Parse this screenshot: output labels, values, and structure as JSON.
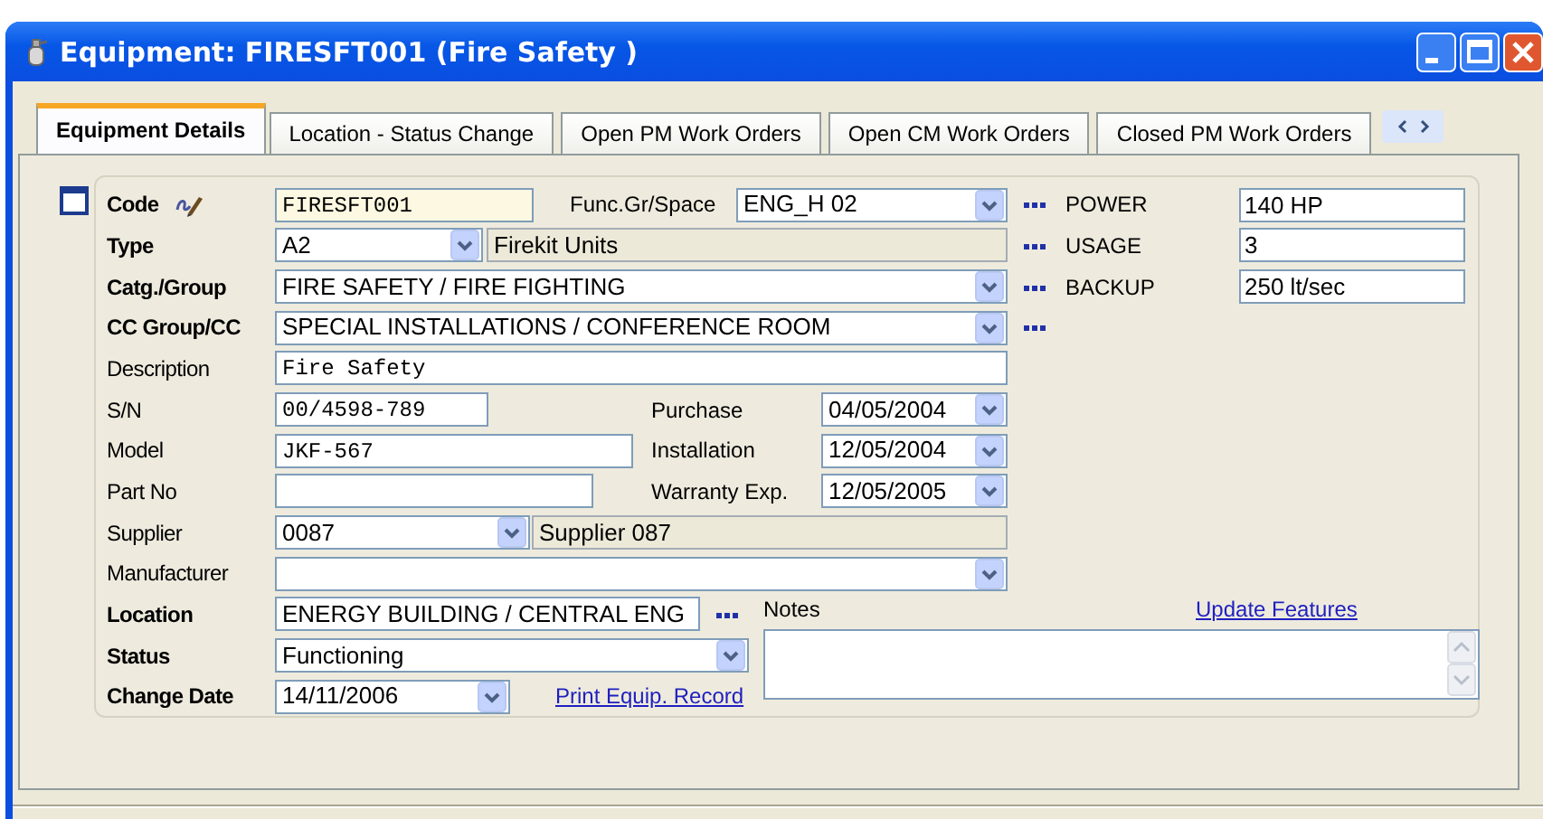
{
  "window": {
    "title": "Equipment: FIRESFT001 (Fire Safety )"
  },
  "tabs": [
    {
      "label": "Equipment Details",
      "selected": true
    },
    {
      "label": "Location - Status Change",
      "selected": false
    },
    {
      "label": "Open PM Work Orders",
      "selected": false
    },
    {
      "label": "Open CM Work Orders",
      "selected": false
    },
    {
      "label": "Closed PM Work Orders",
      "selected": false
    }
  ],
  "form": {
    "rows": [
      {
        "label": "Code",
        "required": true,
        "fields": [
          {
            "kind": "input",
            "value": "FIRESFT001",
            "highlighted": true
          },
          {
            "kind": "label",
            "text": "Func.Gr/Space"
          },
          {
            "kind": "select",
            "value": "ENG_H 02"
          },
          {
            "kind": "lookup"
          }
        ],
        "side": {
          "label": "POWER",
          "value": "140 HP"
        }
      },
      {
        "label": "Type",
        "required": true,
        "fields": [
          {
            "kind": "select",
            "value": "A2"
          },
          {
            "kind": "display",
            "value": "Firekit Units"
          },
          {
            "kind": "lookup"
          }
        ],
        "side": {
          "label": "USAGE",
          "value": "3"
        }
      },
      {
        "label": "Catg./Group",
        "required": true,
        "fields": [
          {
            "kind": "select",
            "value": "FIRE SAFETY / FIRE FIGHTING"
          },
          {
            "kind": "lookup"
          }
        ],
        "side": {
          "label": "BACKUP",
          "value": "250 lt/sec"
        }
      },
      {
        "label": "CC Group/CC",
        "required": true,
        "fields": [
          {
            "kind": "select",
            "value": "SPECIAL INSTALLATIONS / CONFERENCE ROOM"
          },
          {
            "kind": "lookup"
          }
        ]
      },
      {
        "label": "Description",
        "required": false,
        "fields": [
          {
            "kind": "input",
            "value": "Fire Safety",
            "highlighted": false
          }
        ]
      },
      {
        "label": "S/N",
        "required": false,
        "fields": [
          {
            "kind": "input",
            "value": "00/4598-789",
            "highlighted": false
          },
          {
            "kind": "label",
            "text": "Purchase"
          },
          {
            "kind": "date",
            "value": "04/05/2004"
          }
        ]
      },
      {
        "label": "Model",
        "required": false,
        "fields": [
          {
            "kind": "input",
            "value": "JKF-567",
            "highlighted": false
          },
          {
            "kind": "label",
            "text": "Installation"
          },
          {
            "kind": "date",
            "value": "12/05/2004"
          }
        ]
      },
      {
        "label": "Part No",
        "required": false,
        "fields": [
          {
            "kind": "input",
            "highlighted": false
          },
          {
            "kind": "label",
            "text": "Warranty Exp."
          },
          {
            "kind": "date",
            "value": "12/05/2005"
          }
        ]
      },
      {
        "label": "Supplier",
        "required": false,
        "fields": [
          {
            "kind": "select",
            "value": "0087"
          },
          {
            "kind": "display",
            "value": "Supplier 087"
          }
        ]
      },
      {
        "label": "Manufacturer",
        "required": false,
        "fields": [
          {
            "kind": "select"
          }
        ]
      },
      {
        "label": "Location",
        "required": true,
        "fields": [
          {
            "kind": "display-white",
            "value": "ENERGY BUILDING / CENTRAL ENG"
          },
          {
            "kind": "lookup"
          }
        ]
      },
      {
        "label": "Status",
        "required": true,
        "fields": [
          {
            "kind": "select",
            "value": "Functioning"
          }
        ]
      },
      {
        "label": "Change Date",
        "required": true,
        "fields": [
          {
            "kind": "date",
            "value": "14/11/2006"
          },
          {
            "kind": "link",
            "text": "Print Equip. Record"
          }
        ]
      }
    ],
    "notes": {
      "label": "Notes",
      "link": "Update Features"
    }
  }
}
